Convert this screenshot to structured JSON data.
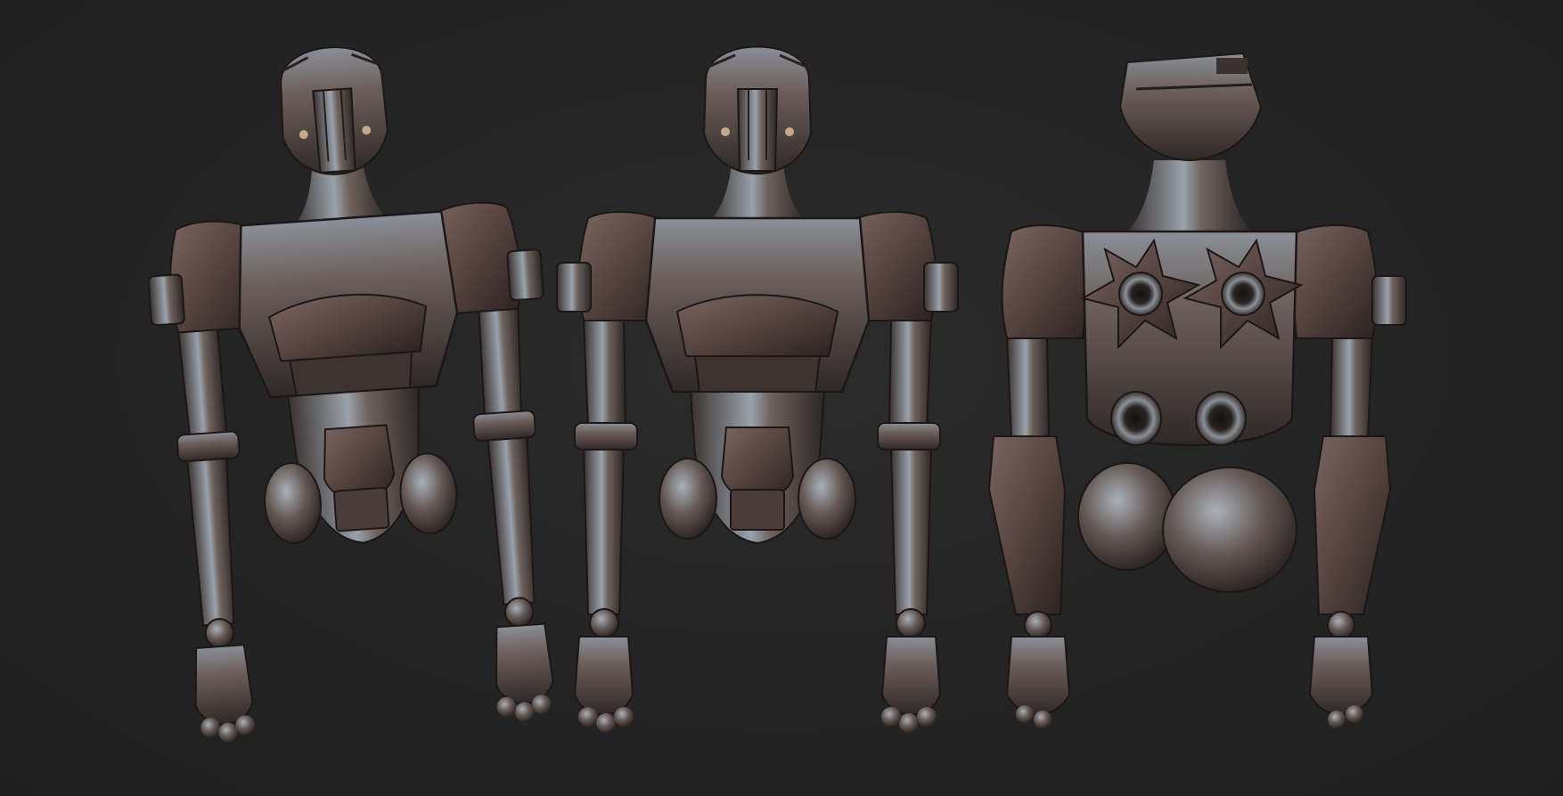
{
  "scene": {
    "background_color": "#232323",
    "metal_light": "#b9c0c8",
    "metal_mid": "#6f6560",
    "metal_dark": "#2e2726",
    "views": [
      {
        "id": "three-quarter-front-view"
      },
      {
        "id": "front-view"
      },
      {
        "id": "back-view"
      }
    ]
  }
}
